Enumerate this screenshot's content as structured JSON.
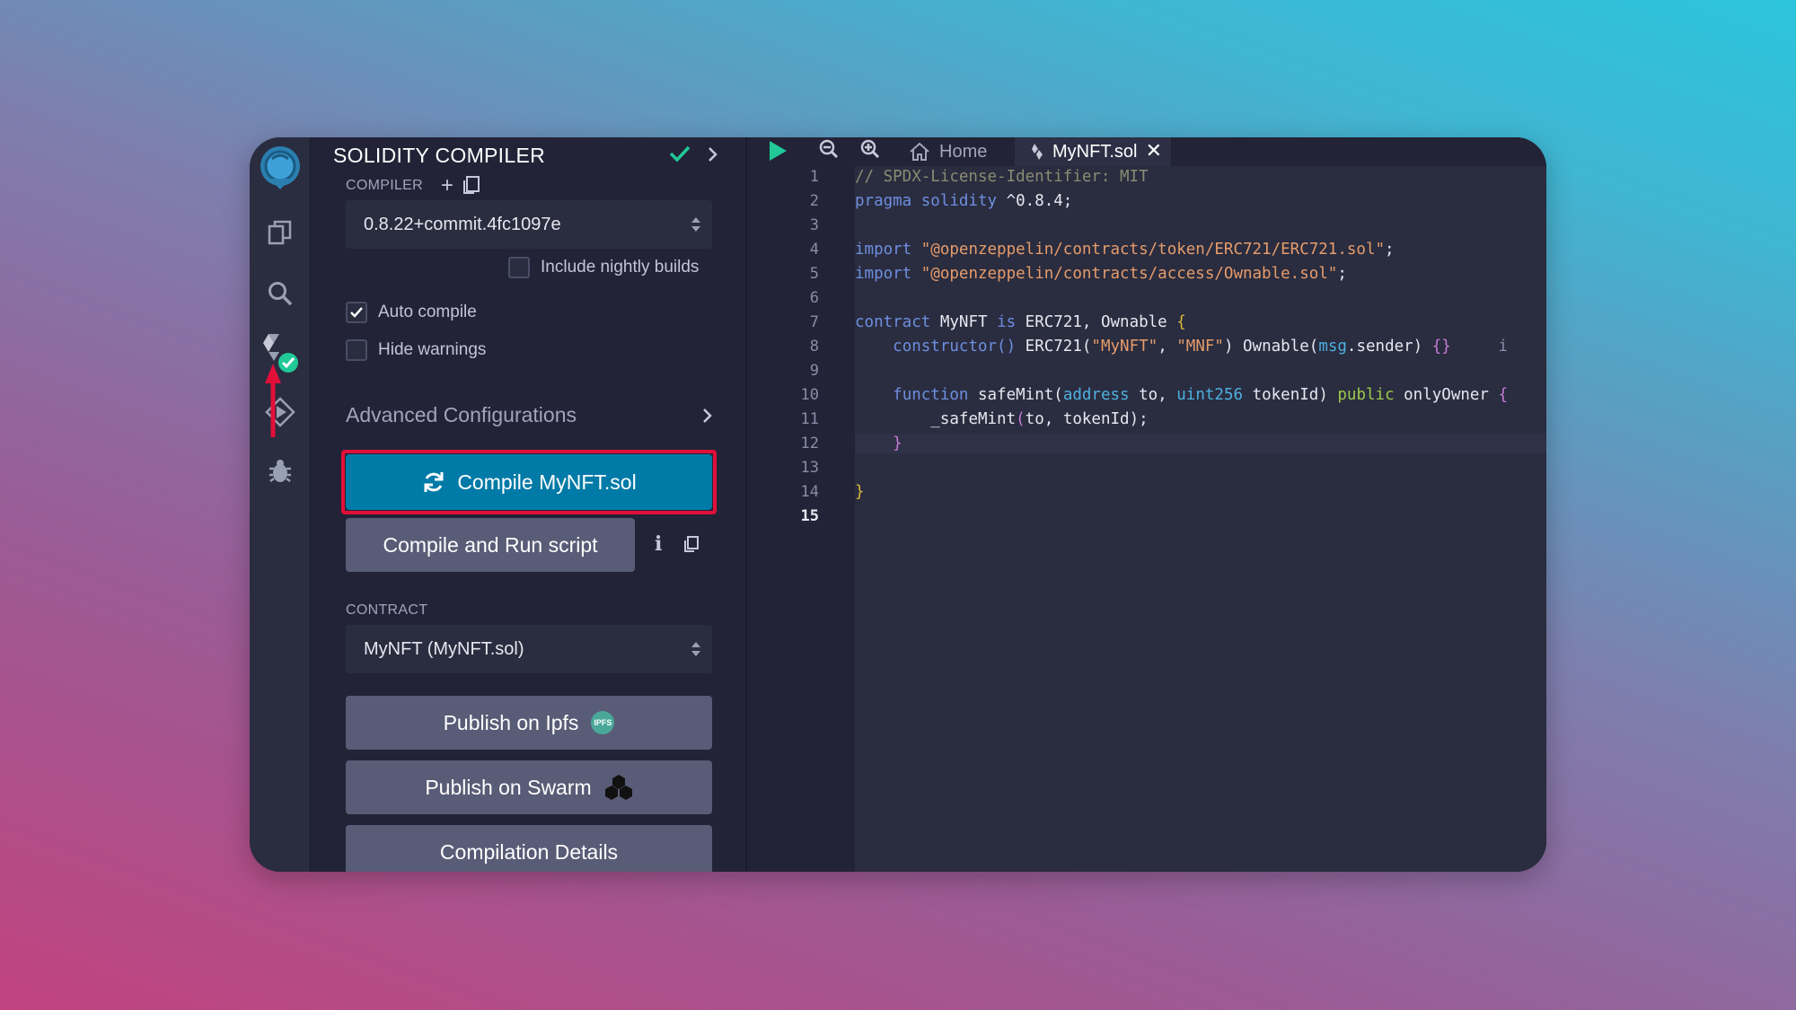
{
  "panel": {
    "title": "SOLIDITY COMPILER",
    "compiler_label": "COMPILER",
    "compiler_version": "0.8.22+commit.4fc1097e",
    "include_nightly_label": "Include nightly builds",
    "include_nightly_checked": false,
    "auto_compile_label": "Auto compile",
    "auto_compile_checked": true,
    "hide_warnings_label": "Hide warnings",
    "hide_warnings_checked": false,
    "advanced_label": "Advanced Configurations",
    "compile_button": "Compile MyNFT.sol",
    "run_script_button": "Compile and Run script",
    "contract_label": "CONTRACT",
    "contract_value": "MyNFT (MyNFT.sol)",
    "publish_ipfs": "Publish on Ipfs",
    "ipfs_badge": "IPFS",
    "publish_swarm": "Publish on Swarm",
    "compilation_details": "Compilation Details"
  },
  "editor": {
    "tabs": [
      {
        "label": "Home",
        "icon": "home-icon"
      },
      {
        "label": "MyNFT.sol",
        "icon": "solidity-icon",
        "active": true
      }
    ],
    "line_numbers": [
      "1",
      "2",
      "3",
      "4",
      "5",
      "6",
      "7",
      "8",
      "9",
      "10",
      "11",
      "12",
      "13",
      "14",
      "15"
    ],
    "active_line": "15",
    "code": {
      "l1": "// SPDX-License-Identifier: MIT",
      "l2_kw": "pragma solidity",
      "l2_rest": " ^0.8.4;",
      "l4_kw": "import",
      "l4_str": "\"@openzeppelin/contracts/token/ERC721/ERC721.sol\"",
      "l5_kw": "import",
      "l5_str": "\"@openzeppelin/contracts/access/Ownable.sol\"",
      "semicolon": ";",
      "l7_kw": "contract",
      "l7_name": " MyNFT ",
      "l7_is": "is",
      "l7_rest": " ERC721, Ownable ",
      "l8_ctor": "constructor()",
      "l8_erc": " ERC721(",
      "l8_s1": "\"MyNFT\"",
      "l8_comma": ", ",
      "l8_s2": "\"MNF\"",
      "l8_own": ") Ownable(",
      "l8_msg": "msg",
      "l8_sender": ".sender) ",
      "l8_braces": "{}",
      "l8_trail": "i",
      "l10_fn": "function",
      "l10_name": " safeMint(",
      "l10_addr": "address",
      "l10_to": " to, ",
      "l10_uint": "uint256",
      "l10_tok": " tokenId) ",
      "l10_pub": "public",
      "l10_only": " onlyOwner ",
      "l11_call": "_safeMint",
      "l11_paren": "(",
      "l11_args": "to, tokenId",
      "l11_end": ");",
      "open_brace": "{",
      "close_brace": "}"
    }
  },
  "colors": {
    "accent_compile": "#007aa6",
    "highlight_box": "#e0103a",
    "success_check": "#20c997"
  }
}
